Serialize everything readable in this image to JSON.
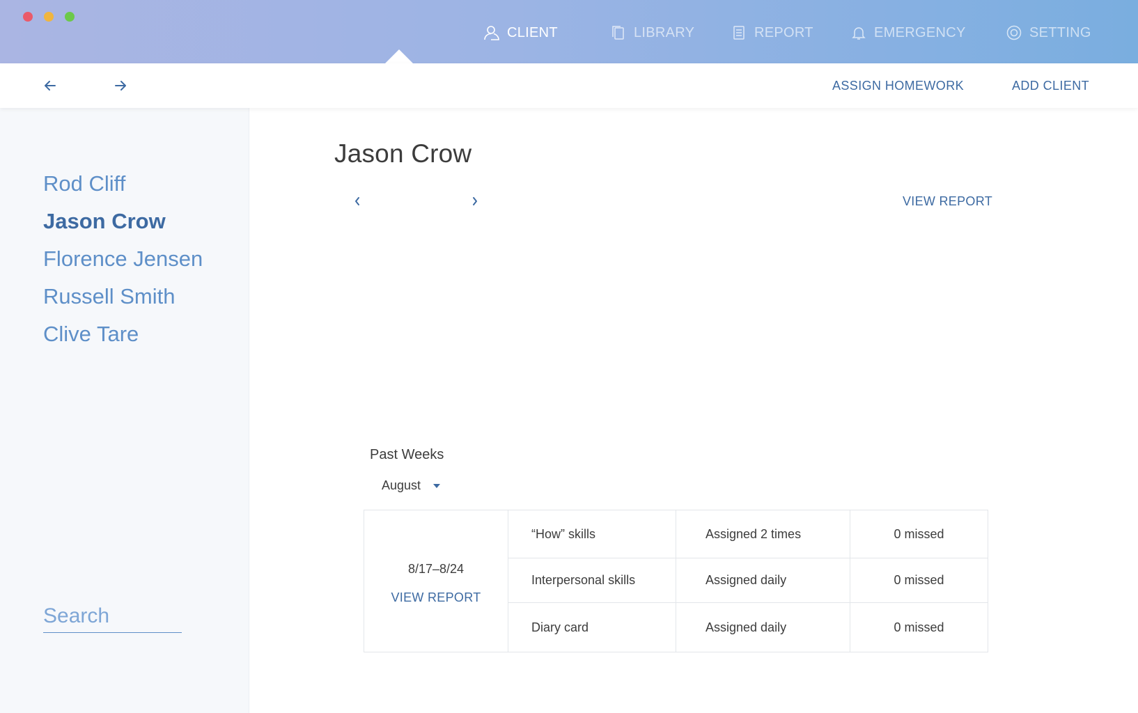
{
  "window": {
    "traffic_lights": [
      "close",
      "minimize",
      "zoom"
    ]
  },
  "nav": {
    "tabs": [
      {
        "label": "CLIENT",
        "icon": "user-icon",
        "active": true
      },
      {
        "label": "LIBRARY",
        "icon": "copy-icon",
        "active": false
      },
      {
        "label": "REPORT",
        "icon": "document-icon",
        "active": false
      },
      {
        "label": "EMERGENCY",
        "icon": "bell-icon",
        "active": false
      },
      {
        "label": "SETTING",
        "icon": "gear-icon",
        "active": false
      }
    ]
  },
  "toolbar": {
    "back_icon": "arrow-left-icon",
    "forward_icon": "arrow-right-icon",
    "assign_homework": "ASSIGN HOMEWORK",
    "add_client": "ADD CLIENT"
  },
  "sidebar": {
    "clients": [
      {
        "name": "Rod Cliff",
        "selected": false
      },
      {
        "name": "Jason Crow",
        "selected": true
      },
      {
        "name": "Florence Jensen",
        "selected": false
      },
      {
        "name": "Russell Smith",
        "selected": false
      },
      {
        "name": "Clive Tare",
        "selected": false
      }
    ],
    "search_placeholder": "Search"
  },
  "main": {
    "client_name": "Jason Crow",
    "view_report": "VIEW REPORT",
    "past_weeks": {
      "title": "Past Weeks",
      "month": "August",
      "weeks": [
        {
          "range": "8/17–8/24",
          "view_report": "VIEW REPORT",
          "rows": [
            {
              "skill": "“How” skills",
              "assigned": "Assigned 2 times",
              "missed": "0 missed"
            },
            {
              "skill": "Interpersonal skills",
              "assigned": "Assigned daily",
              "missed": "0 missed"
            },
            {
              "skill": "Diary card",
              "assigned": "Assigned daily",
              "missed": "0 missed"
            }
          ]
        }
      ]
    }
  },
  "colors": {
    "accent": "#3d6aa2",
    "link_light": "#5e8fc8",
    "header_gradient_start": "#aab5e3",
    "header_gradient_end": "#7aaedf",
    "sidebar_bg": "#f6f8fb"
  }
}
